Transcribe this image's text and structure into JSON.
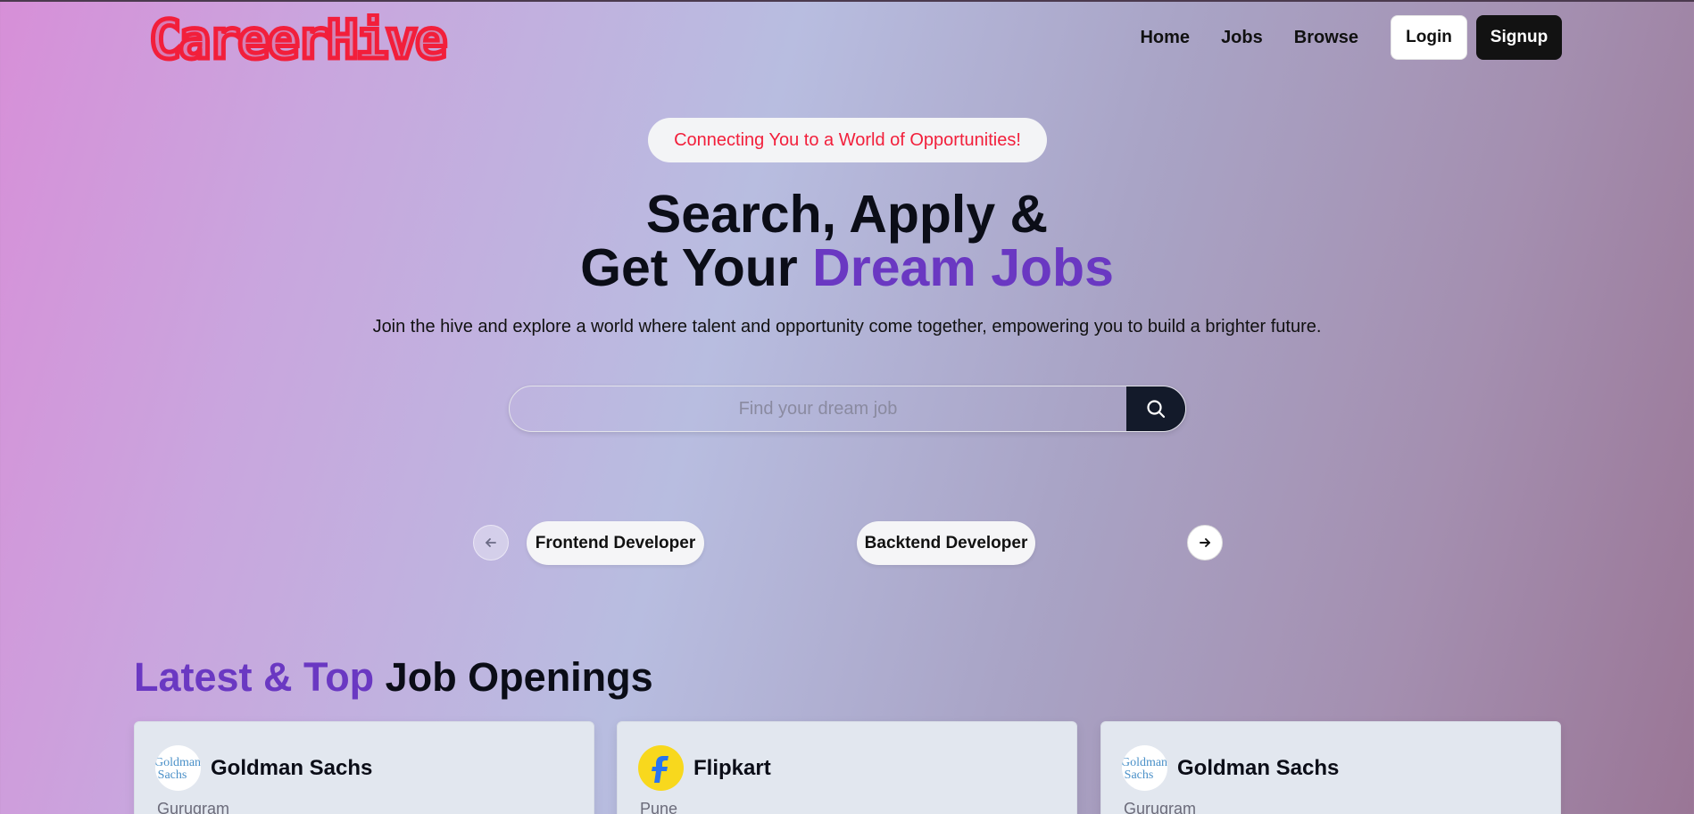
{
  "brand": {
    "name": "CareerHive",
    "color": "#f21f3b"
  },
  "nav": {
    "links": [
      "Home",
      "Jobs",
      "Browse"
    ],
    "login_label": "Login",
    "signup_label": "Signup"
  },
  "hero": {
    "tagline": "Connecting You to a World of Opportunities!",
    "title_line1": "Search, Apply &",
    "title_line2_plain": "Get Your ",
    "title_line2_accent": "Dream Jobs",
    "subtitle": "Join the hive and explore a world where talent and opportunity come together, empowering you to build a brighter future.",
    "accent_color": "#6a38c2"
  },
  "search": {
    "placeholder": "Find your dream job",
    "value": "",
    "icon": "search-icon"
  },
  "categories": {
    "prev_icon": "arrow-left-icon",
    "next_icon": "arrow-right-icon",
    "items": [
      "Frontend Developer",
      "Backtend Developer"
    ]
  },
  "jobs_section": {
    "title_accent": "Latest & Top",
    "title_plain": " Job Openings",
    "cards": [
      {
        "company": "Goldman Sachs",
        "location": "Gurugram",
        "logo": "goldman-sachs-logo"
      },
      {
        "company": "Flipkart",
        "location": "Pune",
        "logo": "flipkart-logo"
      },
      {
        "company": "Goldman Sachs",
        "location": "Gurugram",
        "logo": "goldman-sachs-logo"
      }
    ]
  }
}
